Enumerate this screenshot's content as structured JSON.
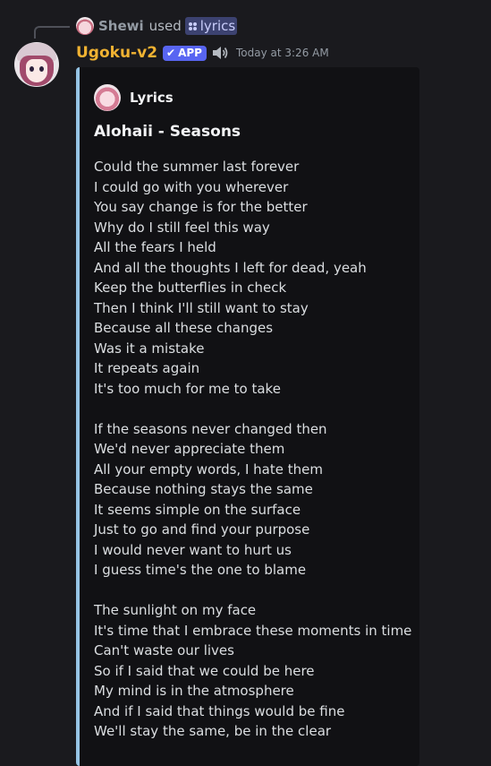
{
  "reply": {
    "user": "Shewi",
    "used_text": "used",
    "command": "lyrics"
  },
  "message": {
    "bot_name": "Ugoku-v2",
    "app_badge": "APP",
    "check_icon": "checkmark-icon",
    "speaker_icon": "speaker-icon",
    "timestamp": "Today at 3:26 AM"
  },
  "embed": {
    "accent_color": "#95c3e4",
    "author": "Lyrics",
    "title": "Alohaii - Seasons",
    "lines": [
      "Could the summer last forever",
      "I could go with you wherever",
      "You say change is for the better",
      "Why do I still feel this way",
      "All the fears I held",
      "And all the thoughts I left for dead, yeah",
      "Keep the butterflies in check",
      "Then I think I'll still want to stay",
      "Because all these changes",
      "Was it a mistake",
      "It repeats again",
      "It's too much for me to take",
      "",
      "If the seasons never changed then",
      "We'd never appreciate them",
      "All your empty words, I hate them",
      "Because nothing stays the same",
      "It seems simple on the surface",
      "Just to go and find your purpose",
      "I would never want to hurt us",
      "I guess time's the one to blame",
      "",
      "The sunlight on my face",
      "It's time that I embrace these moments in time",
      "Can't waste our lives",
      "So if I said that we could be here",
      "My mind is in the atmosphere",
      "And if I said that things would be fine",
      "We'll stay the same, be in the clear"
    ]
  },
  "colors": {
    "background": "#1a1a1e",
    "embed_background": "#111114",
    "bot_name": "#f0b232",
    "app_badge": "#5865f2",
    "command_chip": "#3c4270"
  }
}
